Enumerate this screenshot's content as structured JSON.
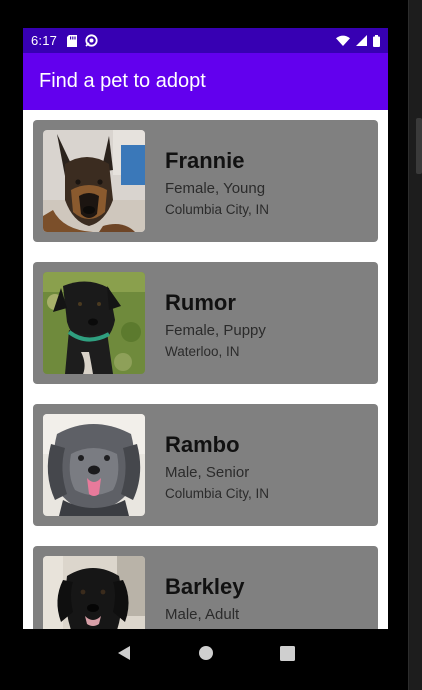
{
  "status_bar": {
    "time": "6:17",
    "icons_left": [
      "sd-card-icon",
      "sync-icon"
    ],
    "icons_right": [
      "wifi-icon",
      "signal-icon",
      "battery-icon"
    ]
  },
  "app_bar": {
    "title": "Find a pet to adopt"
  },
  "pets": [
    {
      "name": "Frannie",
      "info": "Female, Young",
      "location": "Columbia City, IN",
      "photo": "german-shepherd-dog-photo"
    },
    {
      "name": "Rumor",
      "info": "Female, Puppy",
      "location": "Waterloo, IN",
      "photo": "black-dog-on-grass-photo"
    },
    {
      "name": "Rambo",
      "info": "Male, Senior",
      "location": "Columbia City, IN",
      "photo": "gray-curly-dog-photo"
    },
    {
      "name": "Barkley",
      "info": "Male, Adult",
      "location": "",
      "photo": "black-labrador-photo"
    }
  ],
  "nav_bar": {
    "back": "back-icon",
    "home": "home-icon",
    "recents": "recents-icon"
  },
  "colors": {
    "status_bar": "#3700b3",
    "app_bar": "#6200ee",
    "card": "#808080"
  }
}
